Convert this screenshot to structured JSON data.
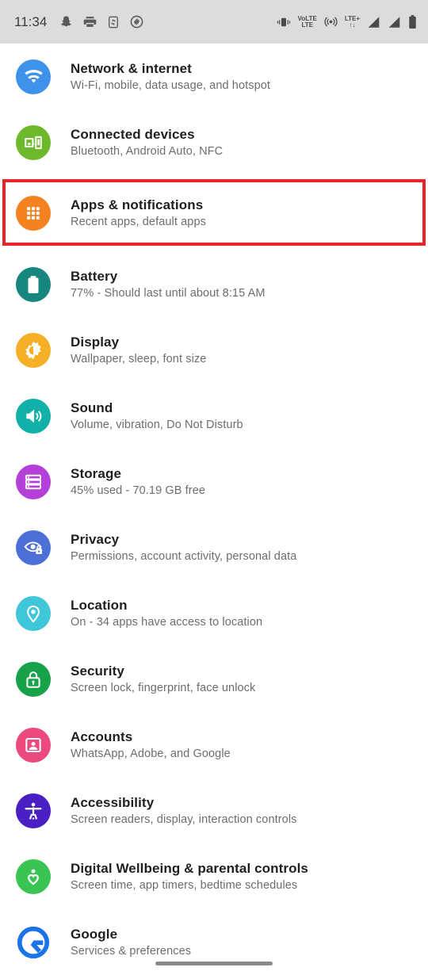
{
  "status_bar": {
    "clock": "11:34",
    "background_color": "#dcdcdc",
    "left_icons": [
      "snapchat-icon",
      "printer-icon",
      "phone-sync-icon",
      "shazam-icon"
    ],
    "right_icons": [
      "vibrate-icon",
      "volte-icon",
      "hotspot-icon",
      "lte-plus-icon",
      "signal-bars-1-icon",
      "signal-bars-2-icon",
      "battery-icon"
    ],
    "volte_top_label": "VoLTE",
    "volte_bottom_label": "LTE",
    "lte_label": "LTE+"
  },
  "highlight": {
    "color": "#e8232a",
    "target_row": "Apps & notifications"
  },
  "settings": {
    "items": [
      {
        "title": "Network & internet",
        "subtitle": "Wi-Fi, mobile, data usage, and hotspot",
        "icon": "wifi-icon",
        "icon_color": "#3f92ea",
        "name": "network-and-internet"
      },
      {
        "title": "Connected devices",
        "subtitle": "Bluetooth, Android Auto, NFC",
        "icon": "connected-devices-icon",
        "icon_color": "#6eb92b",
        "name": "connected-devices"
      },
      {
        "title": "Apps & notifications",
        "subtitle": "Recent apps, default apps",
        "icon": "app-grid-icon",
        "icon_color": "#f58220",
        "name": "apps-and-notifications"
      },
      {
        "title": "Battery",
        "subtitle": "77% - Should last until about 8:15 AM",
        "icon": "battery-icon",
        "icon_color": "#16867e",
        "name": "battery"
      },
      {
        "title": "Display",
        "subtitle": "Wallpaper, sleep, font size",
        "icon": "brightness-icon",
        "icon_color": "#f6b028",
        "name": "display"
      },
      {
        "title": "Sound",
        "subtitle": "Volume, vibration, Do Not Disturb",
        "icon": "speaker-icon",
        "icon_color": "#11b0a8",
        "name": "sound"
      },
      {
        "title": "Storage",
        "subtitle": "45% used - 70.19 GB free",
        "icon": "storage-icon",
        "icon_color": "#b43fd9",
        "name": "storage"
      },
      {
        "title": "Privacy",
        "subtitle": "Permissions, account activity, personal data",
        "icon": "privacy-eye-lock-icon",
        "icon_color": "#4d6fd8",
        "name": "privacy"
      },
      {
        "title": "Location",
        "subtitle": "On - 34 apps have access to location",
        "icon": "location-pin-icon",
        "icon_color": "#3fc6d9",
        "name": "location"
      },
      {
        "title": "Security",
        "subtitle": "Screen lock, fingerprint, face unlock",
        "icon": "lock-icon",
        "icon_color": "#17a24a",
        "name": "security"
      },
      {
        "title": "Accounts",
        "subtitle": "WhatsApp, Adobe, and Google",
        "icon": "account-card-icon",
        "icon_color": "#ec4a7f",
        "name": "accounts"
      },
      {
        "title": "Accessibility",
        "subtitle": "Screen readers, display, interaction controls",
        "icon": "accessibility-icon",
        "icon_color": "#4a1fc4",
        "name": "accessibility"
      },
      {
        "title": "Digital Wellbeing & parental controls",
        "subtitle": "Screen time, app timers, bedtime schedules",
        "icon": "wellbeing-heart-icon",
        "icon_color": "#3ac453",
        "name": "digital-wellbeing"
      },
      {
        "title": "Google",
        "subtitle": "Services & preferences",
        "icon": "google-g-icon",
        "icon_color": "#1a73e8",
        "name": "google"
      }
    ]
  },
  "navigation": {
    "gesture_bar": "home-gesture-bar"
  }
}
